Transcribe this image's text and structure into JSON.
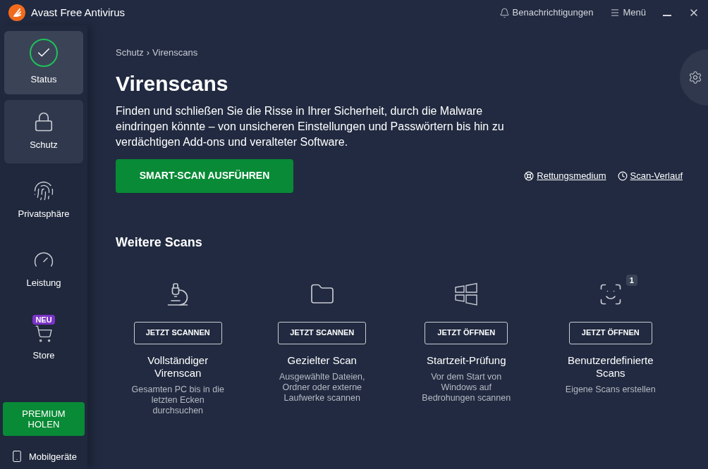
{
  "window": {
    "title": "Avast Free Antivirus",
    "actions": [
      {
        "kind": "bell",
        "label": "Benachrichtigungen"
      },
      {
        "kind": "menu",
        "label": "Menü"
      }
    ]
  },
  "sidebar": {
    "items": [
      {
        "kind": "status",
        "label": "Status",
        "selected": false,
        "hovered": true
      },
      {
        "kind": "lock",
        "label": "Schutz",
        "selected": true,
        "hovered": false
      },
      {
        "kind": "fingerprint",
        "label": "Privatsphäre",
        "selected": false,
        "hovered": false
      },
      {
        "kind": "gauge",
        "label": "Leistung",
        "selected": false,
        "hovered": false
      },
      {
        "kind": "cart",
        "label": "Store",
        "badge": "NEU",
        "selected": false,
        "hovered": false
      }
    ],
    "premium_button": "PREMIUM HOLEN",
    "mobile_link": "Mobilgeräte"
  },
  "breadcrumb": {
    "separator": "›",
    "items": [
      "Schutz",
      "Virenscans"
    ]
  },
  "page": {
    "title": "Virenscans",
    "description": "Finden und schließen Sie die Risse in Ihrer Sicherheit, durch die Malware eindringen könnte – von unsicheren Einstellungen und Passwörtern bis hin zu verdächtigen Add-ons und veralteter Software.",
    "primary_button": "SMART-SCAN AUSFÜHREN",
    "links": [
      {
        "kind": "lifebuoy",
        "label": "Rettungsmedium"
      },
      {
        "kind": "clock",
        "label": "Scan-Verlauf"
      }
    ]
  },
  "more_scans": {
    "title": "Weitere Scans",
    "cards": [
      {
        "kind": "microscope",
        "button": "JETZT SCANNEN",
        "title": "Vollständiger Virenscan",
        "description": "Gesamten PC bis in die letzten Ecken durchsuchen"
      },
      {
        "kind": "folder",
        "button": "JETZT SCANNEN",
        "title": "Gezielter Scan",
        "description": "Ausgewählte Dateien, Ordner oder externe Laufwerke scannen"
      },
      {
        "kind": "windows",
        "button": "JETZT ÖFFNEN",
        "title": "Startzeit-Prüfung",
        "description": "Vor dem Start von Windows auf Bedrohungen scannen"
      },
      {
        "kind": "custom",
        "badge": "1",
        "button": "JETZT ÖFFNEN",
        "title": "Benutzerdefinierte Scans",
        "description": "Eigene Scans erstellen"
      }
    ]
  }
}
